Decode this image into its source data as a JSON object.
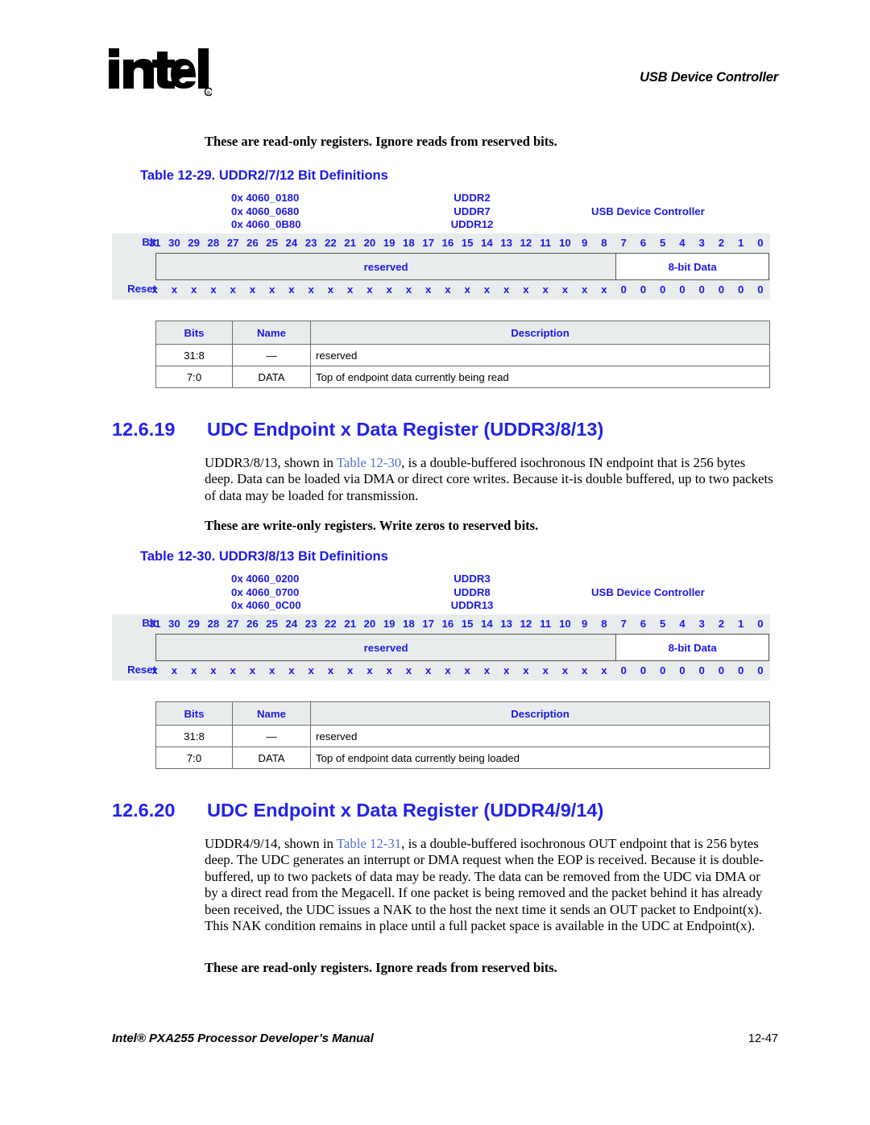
{
  "header": {
    "logo_text": "intel",
    "logo_mark": "registered-trademark",
    "title": "USB Device Controller"
  },
  "notes": {
    "read_only_1": "These are read-only registers. Ignore reads from reserved bits.",
    "write_only": "These are write-only registers. Write zeros to reserved bits.",
    "read_only_2": "These are read-only registers. Ignore reads from reserved bits."
  },
  "table_29": {
    "caption": "Table 12-29. UDDR2/7/12 Bit Definitions",
    "addresses": [
      "0x 4060_0180",
      "0x 4060_0680",
      "0x 4060_0B80"
    ],
    "names": [
      "UDDR2",
      "UDDR7",
      "UDDR12"
    ],
    "unit": "USB Device Controller",
    "bit_label": "Bit",
    "reset_label": "Reset",
    "bits": [
      "31",
      "30",
      "29",
      "28",
      "27",
      "26",
      "25",
      "24",
      "23",
      "22",
      "21",
      "20",
      "19",
      "18",
      "17",
      "16",
      "15",
      "14",
      "13",
      "12",
      "11",
      "10",
      "9",
      "8",
      "7",
      "6",
      "5",
      "4",
      "3",
      "2",
      "1",
      "0"
    ],
    "fields": [
      {
        "label": "reserved",
        "span": 24,
        "style": "gray"
      },
      {
        "label": "8-bit Data",
        "span": 8,
        "style": "white"
      }
    ],
    "reset_values": [
      "x",
      "x",
      "x",
      "x",
      "x",
      "x",
      "x",
      "x",
      "x",
      "x",
      "x",
      "x",
      "x",
      "x",
      "x",
      "x",
      "x",
      "x",
      "x",
      "x",
      "x",
      "x",
      "x",
      "x",
      "0",
      "0",
      "0",
      "0",
      "0",
      "0",
      "0",
      "0"
    ],
    "defs_headers": [
      "Bits",
      "Name",
      "Description"
    ],
    "defs_rows": [
      {
        "bits": "31:8",
        "name": "—",
        "description": "reserved"
      },
      {
        "bits": "7:0",
        "name": "DATA",
        "description": "Top of endpoint data currently being read"
      }
    ]
  },
  "section_19": {
    "number": "12.6.19",
    "title": "UDC Endpoint x Data Register (UDDR3/8/13)",
    "body_pre": "UDDR3/8/13, shown in ",
    "body_xref": "Table 12-30",
    "body_post": ", is a double-buffered isochronous IN endpoint that is 256 bytes deep. Data can be loaded via DMA or direct core writes. Because it-is double buffered, up to two packets of data may be loaded for transmission."
  },
  "table_30": {
    "caption": "Table 12-30. UDDR3/8/13 Bit Definitions",
    "addresses": [
      "0x 4060_0200",
      "0x 4060_0700",
      "0x 4060_0C00"
    ],
    "names": [
      "UDDR3",
      "UDDR8",
      "UDDR13"
    ],
    "unit": "USB Device Controller",
    "bit_label": "Bit",
    "reset_label": "Reset",
    "bits": [
      "31",
      "30",
      "29",
      "28",
      "27",
      "26",
      "25",
      "24",
      "23",
      "22",
      "21",
      "20",
      "19",
      "18",
      "17",
      "16",
      "15",
      "14",
      "13",
      "12",
      "11",
      "10",
      "9",
      "8",
      "7",
      "6",
      "5",
      "4",
      "3",
      "2",
      "1",
      "0"
    ],
    "fields": [
      {
        "label": "reserved",
        "span": 24,
        "style": "gray"
      },
      {
        "label": "8-bit Data",
        "span": 8,
        "style": "white"
      }
    ],
    "reset_values": [
      "x",
      "x",
      "x",
      "x",
      "x",
      "x",
      "x",
      "x",
      "x",
      "x",
      "x",
      "x",
      "x",
      "x",
      "x",
      "x",
      "x",
      "x",
      "x",
      "x",
      "x",
      "x",
      "x",
      "x",
      "0",
      "0",
      "0",
      "0",
      "0",
      "0",
      "0",
      "0"
    ],
    "defs_headers": [
      "Bits",
      "Name",
      "Description"
    ],
    "defs_rows": [
      {
        "bits": "31:8",
        "name": "—",
        "description": "reserved"
      },
      {
        "bits": "7:0",
        "name": "DATA",
        "description": "Top of endpoint data currently being loaded"
      }
    ]
  },
  "section_20": {
    "number": "12.6.20",
    "title": "UDC Endpoint x Data Register (UDDR4/9/14)",
    "body_pre": "UDDR4/9/14, shown in ",
    "body_xref": "Table 12-31",
    "body_post": ", is a double-buffered isochronous OUT endpoint that is 256 bytes deep. The UDC generates an interrupt or DMA request when the EOP is received. Because it is double-buffered, up to two packets of data may be ready. The data can be removed from the UDC via DMA or by a direct read from the Megacell. If one packet is being removed and the packet behind it has already been received, the UDC issues a NAK to the host the next time it sends an OUT packet to Endpoint(x). This NAK condition remains in place until a full packet space is available in the UDC at Endpoint(x)."
  },
  "footer": {
    "left": "Intel® PXA255 Processor Developer’s Manual",
    "right": "12-47"
  },
  "colors": {
    "heading_blue": "#2222ee",
    "table_blue": "#1a1ae8",
    "xref_blue": "#4f6fd6",
    "row_gray": "#e8ecec",
    "border_gray": "#6e6e6e"
  }
}
